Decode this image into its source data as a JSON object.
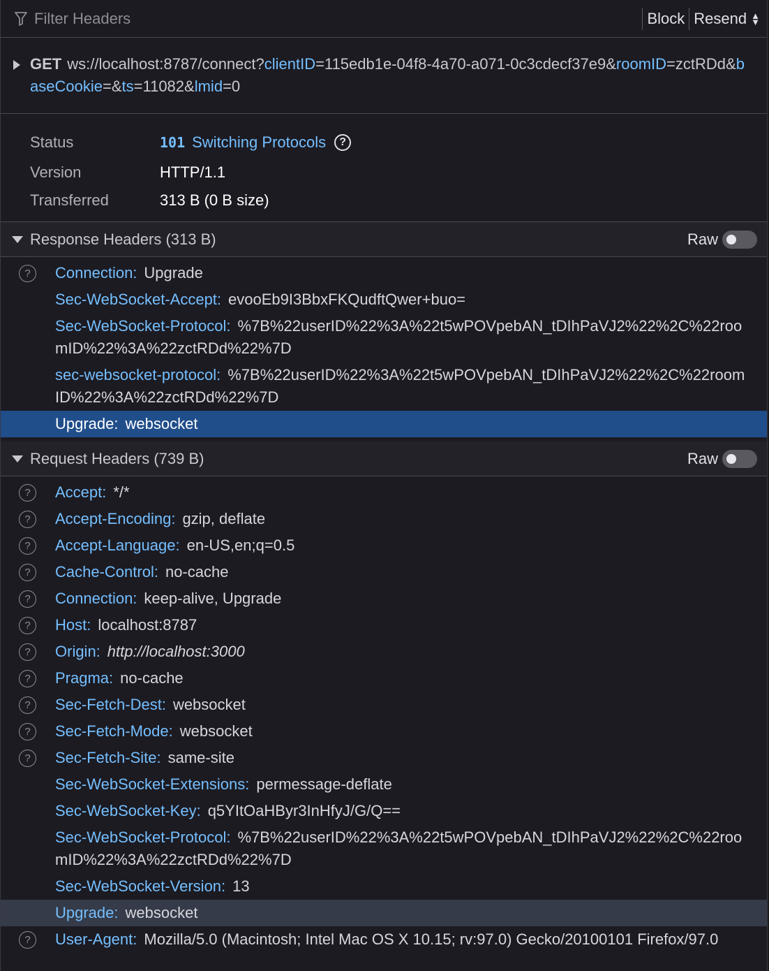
{
  "toolbar": {
    "filter_placeholder": "Filter Headers",
    "block_label": "Block",
    "resend_label": "Resend",
    "resend_icon": "⇕"
  },
  "url": {
    "method": "GET",
    "base": "ws://localhost:8787/connect?",
    "params": [
      {
        "key": "clientID",
        "eq": "=",
        "value": "115edb1e-04f8-4a70-a071-0c3cdecf37e9",
        "amp": "&"
      },
      {
        "key": "roomID",
        "eq": "=",
        "value": "zctRDd",
        "amp": "&"
      },
      {
        "key": "baseCookie",
        "eq": "=",
        "value": "",
        "amp": "&"
      },
      {
        "key": "ts",
        "eq": "=",
        "value": "11082",
        "amp": "&"
      },
      {
        "key": "lmid",
        "eq": "=",
        "value": "0",
        "amp": ""
      }
    ]
  },
  "summary": {
    "status_label": "Status",
    "status_code": "101",
    "status_text": "Switching Protocols",
    "help_glyph": "?",
    "version_label": "Version",
    "version_value": "HTTP/1.1",
    "transferred_label": "Transferred",
    "transferred_value": "313 B (0 B size)"
  },
  "response_headers": {
    "title": "Response Headers (313 B)",
    "raw_label": "Raw",
    "rows": [
      {
        "name": "Connection:",
        "value": "Upgrade",
        "help": true
      },
      {
        "name": "Sec-WebSocket-Accept:",
        "value": "evooEb9I3BbxFKQudftQwer+buo=",
        "help": false
      },
      {
        "name": "Sec-WebSocket-Protocol:",
        "value": "%7B%22userID%22%3A%22t5wPOVpebAN_tDIhPaVJ2%22%2C%22roomID%22%3A%22zctRDd%22%7D",
        "help": false
      },
      {
        "name": "sec-websocket-protocol:",
        "value": "%7B%22userID%22%3A%22t5wPOVpebAN_tDIhPaVJ2%22%2C%22roomID%22%3A%22zctRDd%22%7D",
        "help": false
      },
      {
        "name": "Upgrade:",
        "value": "websocket",
        "help": false,
        "state": "selected"
      }
    ]
  },
  "request_headers": {
    "title": "Request Headers (739 B)",
    "raw_label": "Raw",
    "rows": [
      {
        "name": "Accept:",
        "value": "*/*",
        "help": true
      },
      {
        "name": "Accept-Encoding:",
        "value": "gzip, deflate",
        "help": true
      },
      {
        "name": "Accept-Language:",
        "value": "en-US,en;q=0.5",
        "help": true
      },
      {
        "name": "Cache-Control:",
        "value": "no-cache",
        "help": true
      },
      {
        "name": "Connection:",
        "value": "keep-alive, Upgrade",
        "help": true
      },
      {
        "name": "Host:",
        "value": "localhost:8787",
        "help": true
      },
      {
        "name": "Origin:",
        "value": "http://localhost:3000",
        "help": true,
        "italic": true
      },
      {
        "name": "Pragma:",
        "value": "no-cache",
        "help": true
      },
      {
        "name": "Sec-Fetch-Dest:",
        "value": "websocket",
        "help": true
      },
      {
        "name": "Sec-Fetch-Mode:",
        "value": "websocket",
        "help": true
      },
      {
        "name": "Sec-Fetch-Site:",
        "value": "same-site",
        "help": true
      },
      {
        "name": "Sec-WebSocket-Extensions:",
        "value": "permessage-deflate",
        "help": false
      },
      {
        "name": "Sec-WebSocket-Key:",
        "value": "q5YItOaHByr3InHfyJ/G/Q==",
        "help": false
      },
      {
        "name": "Sec-WebSocket-Protocol:",
        "value": "%7B%22userID%22%3A%22t5wPOVpebAN_tDIhPaVJ2%22%2C%22roomID%22%3A%22zctRDd%22%7D",
        "help": false
      },
      {
        "name": "Sec-WebSocket-Version:",
        "value": "13",
        "help": false
      },
      {
        "name": "Upgrade:",
        "value": "websocket",
        "help": false,
        "state": "highlighted"
      },
      {
        "name": "User-Agent:",
        "value": "Mozilla/5.0 (Macintosh; Intel Mac OS X 10.15; rv:97.0) Gecko/20100101 Firefox/97.0",
        "help": true
      }
    ]
  },
  "colors": {
    "background": "#1c1b22",
    "accent_blue": "#75bfff",
    "selected_row": "#204e8a",
    "highlight_row": "#353b48"
  }
}
